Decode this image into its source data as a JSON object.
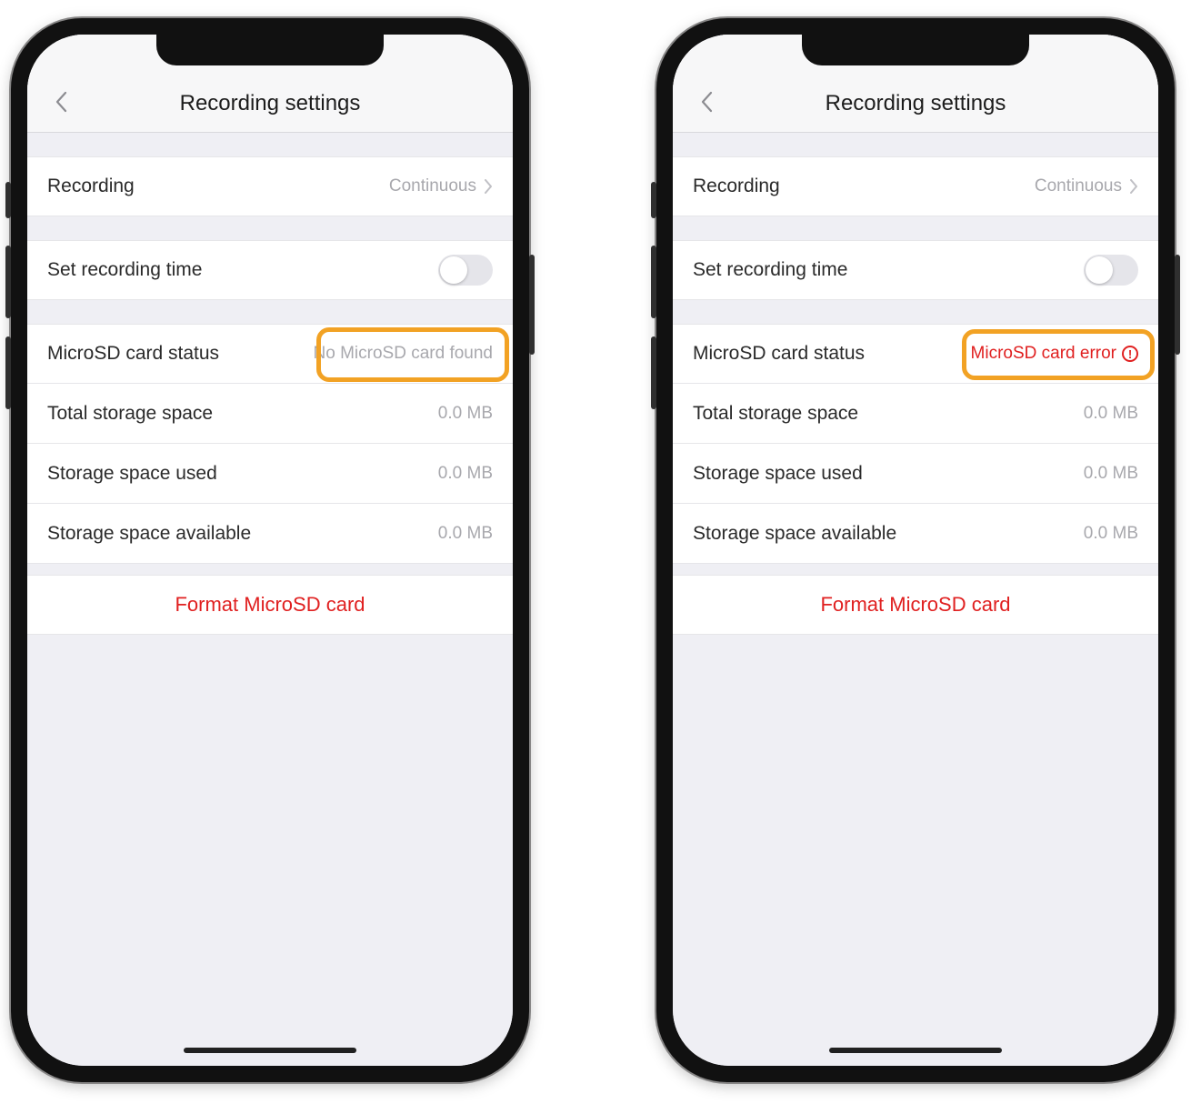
{
  "colors": {
    "highlight": "#f2a224",
    "error": "#e02020",
    "muted": "#a8a8ad"
  },
  "left": {
    "header": {
      "title": "Recording settings"
    },
    "rows": {
      "recording": {
        "label": "Recording",
        "value": "Continuous"
      },
      "setTime": {
        "label": "Set recording time",
        "on": false
      },
      "sdStatus": {
        "label": "MicroSD card status",
        "value": "No MicroSD card found",
        "error": false
      },
      "total": {
        "label": "Total storage space",
        "value": "0.0 MB"
      },
      "used": {
        "label": "Storage space used",
        "value": "0.0 MB"
      },
      "avail": {
        "label": "Storage space available",
        "value": "0.0 MB"
      }
    },
    "actions": {
      "format": "Format MicroSD card"
    }
  },
  "right": {
    "header": {
      "title": "Recording settings"
    },
    "rows": {
      "recording": {
        "label": "Recording",
        "value": "Continuous"
      },
      "setTime": {
        "label": "Set recording time",
        "on": false
      },
      "sdStatus": {
        "label": "MicroSD card status",
        "value": "MicroSD card error",
        "error": true
      },
      "total": {
        "label": "Total storage space",
        "value": "0.0 MB"
      },
      "used": {
        "label": "Storage space used",
        "value": "0.0 MB"
      },
      "avail": {
        "label": "Storage space available",
        "value": "0.0 MB"
      }
    },
    "actions": {
      "format": "Format MicroSD card"
    }
  }
}
